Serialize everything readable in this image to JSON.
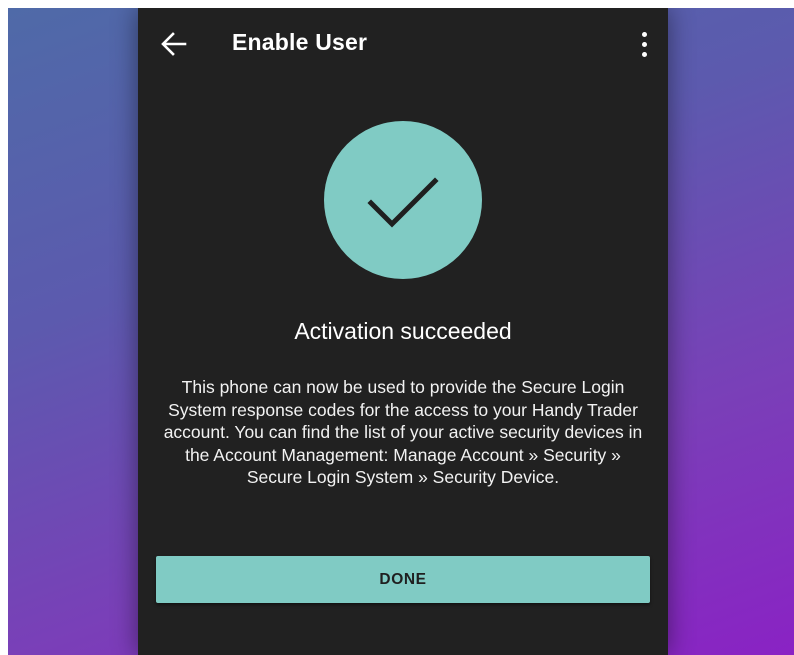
{
  "toolbar": {
    "title": "Enable User",
    "back_icon": "arrow-left-icon",
    "menu_icon": "more-vert-icon"
  },
  "status": {
    "icon": "check-circle-icon",
    "headline": "Activation succeeded",
    "message": "This phone can now be used to provide the Secure Login System response codes for the access to your Handy Trader account. You can find the list of your active security devices in the Account Management: Manage Account » Security » Secure Login System » Security Device."
  },
  "actions": {
    "done_label": "DONE"
  },
  "colors": {
    "accent": "#80cbc4",
    "surface": "#212121",
    "text": "#ffffff",
    "button_text": "#1f1f1f"
  }
}
